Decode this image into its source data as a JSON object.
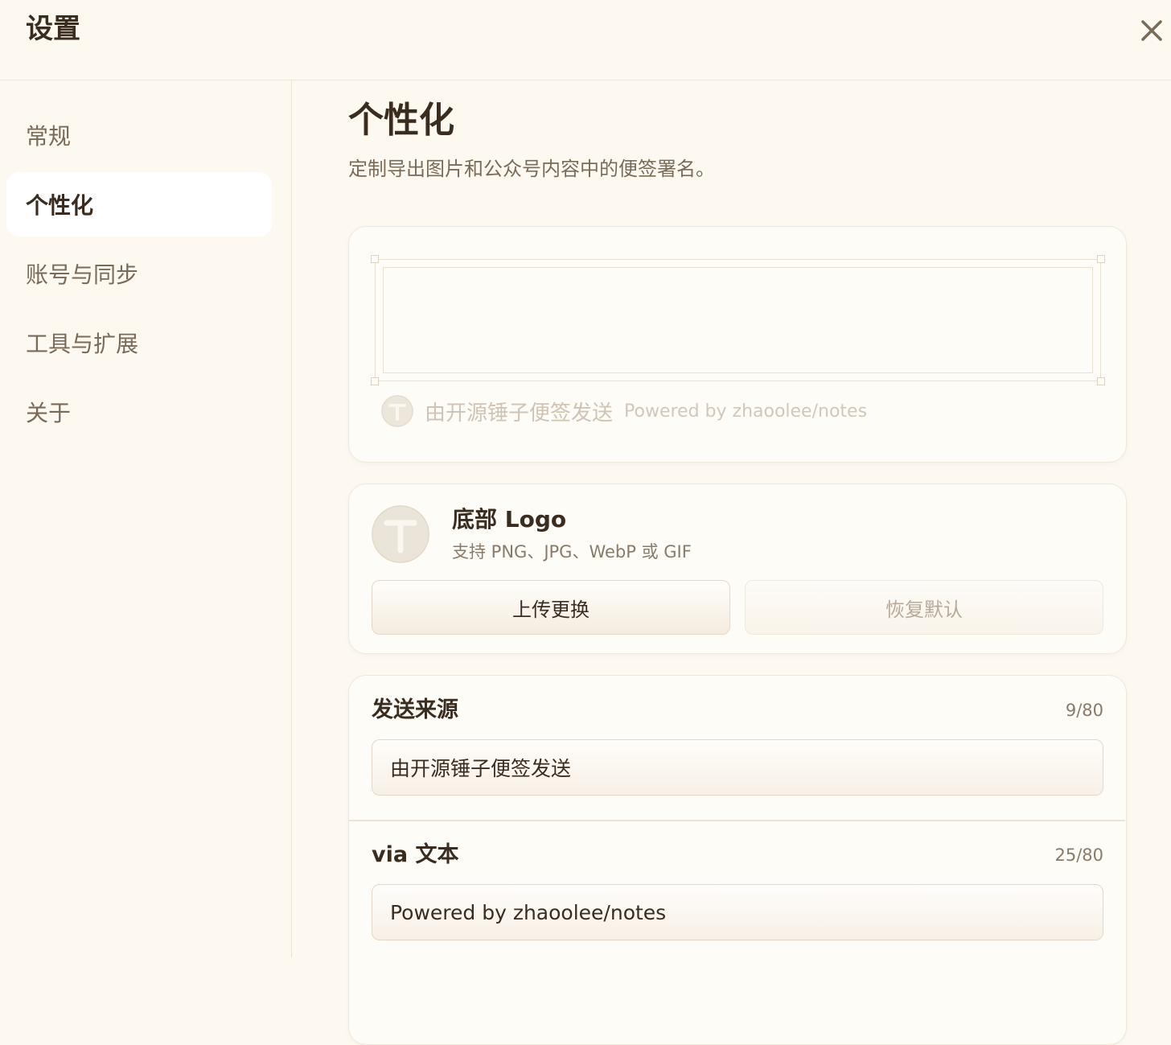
{
  "header": {
    "title": "设置",
    "close_icon": "close-icon"
  },
  "sidebar": {
    "items": [
      {
        "label": "常规",
        "active": false
      },
      {
        "label": "个性化",
        "active": true
      },
      {
        "label": "账号与同步",
        "active": false
      },
      {
        "label": "工具与扩展",
        "active": false
      },
      {
        "label": "关于",
        "active": false
      }
    ]
  },
  "page": {
    "title": "个性化",
    "subtitle": "定制导出图片和公众号内容中的便签署名。"
  },
  "preview": {
    "signature_source": "由开源锤子便签发送",
    "signature_via": "Powered by zhaoolee/notes",
    "logo_icon": "t-logo-icon"
  },
  "logo_section": {
    "title": "底部 Logo",
    "hint": "支持 PNG、JPG、WebP 或 GIF",
    "upload_label": "上传更换",
    "reset_label": "恢复默认"
  },
  "fields": {
    "source": {
      "label": "发送来源",
      "count": "9/80",
      "value": "由开源锤子便签发送"
    },
    "via": {
      "label": "via 文本",
      "count": "25/80",
      "value": "Powered by zhaoolee/notes"
    }
  },
  "colors": {
    "background": "#fdf9f1",
    "text": "#3a2c1e",
    "muted_text": "#7a6a58",
    "card_border": "#efe7d9"
  }
}
